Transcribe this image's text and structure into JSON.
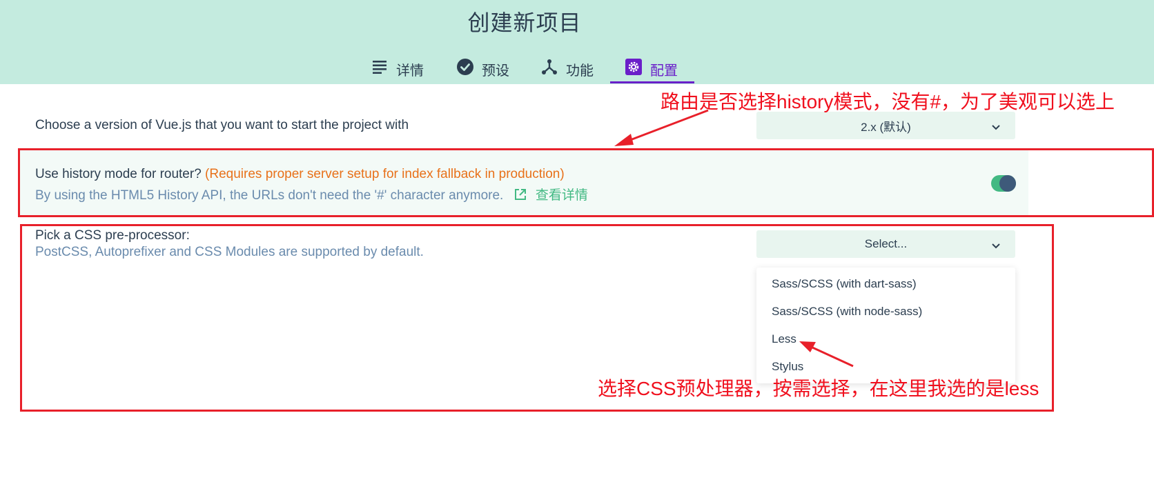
{
  "header": {
    "title": "创建新项目",
    "tabs": [
      {
        "label": "详情",
        "icon": "list-icon"
      },
      {
        "label": "预设",
        "icon": "check-circle-icon"
      },
      {
        "label": "功能",
        "icon": "fork-icon"
      },
      {
        "label": "配置",
        "icon": "gear-icon"
      }
    ],
    "active_tab": "配置"
  },
  "vue_version": {
    "label": "Choose a version of Vue.js that you want to start the project with",
    "selected": "2.x (默认)"
  },
  "history_mode": {
    "label": "Use history mode for router?",
    "warning": "(Requires proper server setup for index fallback in production)",
    "description": "By using the HTML5 History API, the URLs don't need the '#' character anymore.",
    "link": "查看详情",
    "enabled": true
  },
  "css_preprocessor": {
    "label": "Pick a CSS pre-processor:",
    "description": "PostCSS, Autoprefixer and CSS Modules are supported by default.",
    "placeholder": "Select...",
    "options": [
      "Sass/SCSS (with dart-sass)",
      "Sass/SCSS (with node-sass)",
      "Less",
      "Stylus"
    ]
  },
  "annotations": {
    "history_note": "路由是否选择history模式，没有#，为了美观可以选上",
    "css_note": "选择CSS预处理器，按需选择，在这里我选的是less"
  },
  "colors": {
    "header_bg": "#c4ebdf",
    "accent": "#42b983",
    "active_tab": "#6a1fc9",
    "warning": "#e8711a",
    "annotation_red": "#e8202a"
  }
}
